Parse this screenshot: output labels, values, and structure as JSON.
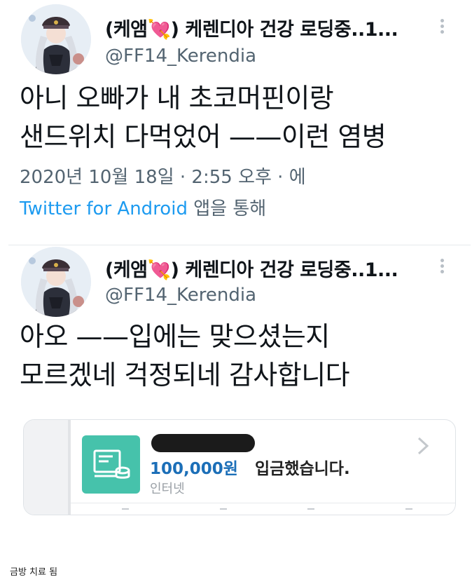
{
  "tweets": [
    {
      "display_name": "(케앰💘) 케렌디아 건강 로딩중..1...",
      "handle": "@FF14_Kerendia",
      "text": "아니 오빠가 내 초코머핀이랑\n샌드위치 다먹었어 ——이런 염병",
      "timestamp": "2020년 10월 18일 · 2:55 오후 · 에",
      "source": "Twitter for Android",
      "source_suffix": " 앱을 통해"
    },
    {
      "display_name": "(케앰💘) 케렌디아 건강 로딩중..1...",
      "handle": "@FF14_Kerendia",
      "text": "아오 ——입에는 맞으셨는지\n모르겠네 걱정되네 감사합니다",
      "attachment": {
        "amount": "100,000원",
        "message": " 입금했습니다.",
        "sub": "인터넷"
      }
    }
  ],
  "caption": "금방 치료 됨",
  "colors": {
    "link": "#1d9bf0",
    "secondary_text": "#536471",
    "bank_icon": "#46c2ab",
    "amount": "#1c6fb8"
  },
  "icons": {
    "more": "more-vertical-icon",
    "bank": "bank-deposit-icon",
    "chevron": "chevron-right-icon"
  }
}
